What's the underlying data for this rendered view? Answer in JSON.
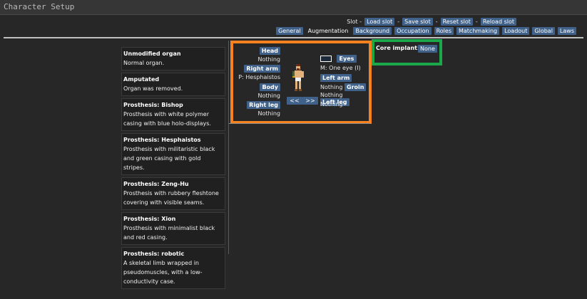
{
  "window": {
    "title": "Character Setup"
  },
  "slot": {
    "label": "Slot -",
    "buttons": [
      "Load slot",
      "Save slot",
      "Reset slot",
      "Reload slot"
    ],
    "separator": "-"
  },
  "tabs": [
    "General",
    "Augmentation",
    "Background",
    "Occupation",
    "Roles",
    "Matchmaking",
    "Loadout",
    "Global",
    "Laws"
  ],
  "selected_tab": "Augmentation",
  "organs": [
    {
      "name": "Unmodified organ",
      "desc": "Normal organ."
    },
    {
      "name": "Amputated",
      "desc": "Organ was removed."
    },
    {
      "name": "Prosthesis: Bishop",
      "desc": "Prosthesis with white polymer casing with blue holo-displays."
    },
    {
      "name": "Prosthesis: Hesphaistos",
      "desc": "Prosthesis with militaristic black and green casing with gold stripes."
    },
    {
      "name": "Prosthesis: Zeng-Hu",
      "desc": "Prosthesis with rubbery fleshtone covering with visible seams."
    },
    {
      "name": "Prosthesis: Xion",
      "desc": "Prosthesis with minimalist black and red casing."
    },
    {
      "name": "Prosthesis: robotic",
      "desc": "A skeletal limb wrapped in pseudomuscles, with a low-conductivity case."
    }
  ],
  "body_panel": {
    "head": {
      "label": "Head",
      "value": "Nothing"
    },
    "right_arm": {
      "label": "Right arm",
      "value": "P: Hesphaistos"
    },
    "body": {
      "label": "Body",
      "value": "Nothing"
    },
    "right_leg": {
      "label": "Right leg",
      "value": "Nothing"
    },
    "eyes": {
      "label": "Eyes",
      "value": "M: One eye (I)"
    },
    "left_arm": {
      "label": "Left arm",
      "value": "Nothing"
    },
    "groin": {
      "label": "Groin",
      "value": "Nothing"
    },
    "left_leg": {
      "label": "Left leg",
      "value": "Nothing"
    },
    "prev": "<<",
    "next": ">>"
  },
  "core_implant": {
    "label": "Core implant:",
    "value": "None"
  },
  "colors": {
    "accent_orange": "#f6821f",
    "accent_green": "#1aa84a",
    "button": "#40628a"
  }
}
